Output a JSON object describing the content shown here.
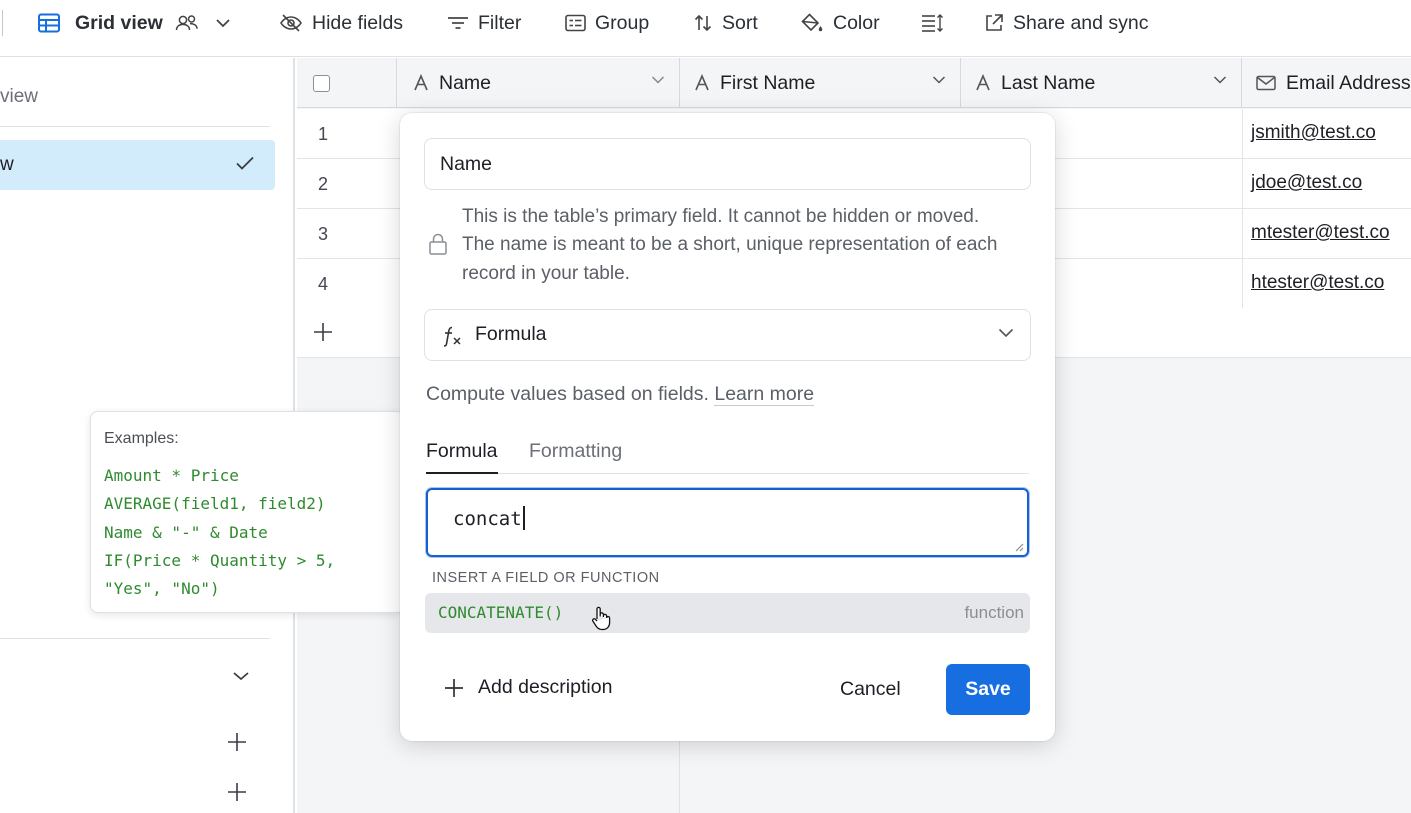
{
  "toolbar": {
    "view_name": "Grid view",
    "hide_fields": "Hide fields",
    "filter": "Filter",
    "group": "Group",
    "sort": "Sort",
    "color": "Color",
    "share_sync": "Share and sync"
  },
  "sidebar": {
    "search_fragment": "view",
    "active_view_fragment": "w"
  },
  "grid": {
    "columns": [
      {
        "label": "Name",
        "icon": "text-field-icon"
      },
      {
        "label": "First Name",
        "icon": "text-field-icon"
      },
      {
        "label": "Last Name",
        "icon": "text-field-icon"
      },
      {
        "label": "Email Address",
        "icon": "mail-icon"
      }
    ],
    "rows": [
      {
        "num": "1",
        "email": "jsmith@test.co"
      },
      {
        "num": "2",
        "email": "jdoe@test.co"
      },
      {
        "num": "3",
        "email": "mtester@test.co"
      },
      {
        "num": "4",
        "email": "htester@test.co"
      }
    ]
  },
  "examples": {
    "title": "Examples:",
    "lines": [
      "Amount * Price",
      "AVERAGE(field1, field2)",
      "Name & \"-\" & Date",
      "IF(Price * Quantity > 5,",
      "\"Yes\", \"No\")"
    ]
  },
  "dialog": {
    "field_name": "Name",
    "primary_note": "This is the table’s primary field. It cannot be hidden or moved. The name is meant to be a short, unique representation of each record in your table.",
    "field_type": "Formula",
    "compute_text": "Compute values based on fields.",
    "learn_more": "Learn more",
    "tabs": [
      "Formula",
      "Formatting"
    ],
    "formula_value": "concat",
    "insert_label": "INSERT A FIELD OR FUNCTION",
    "suggestion": {
      "name": "CONCATENATE()",
      "kind": "function"
    },
    "add_description": "Add description",
    "cancel": "Cancel",
    "save": "Save"
  },
  "colors": {
    "accent": "#166ee1",
    "focus_border": "#1660d0",
    "selected_view_bg": "#d2ecfb",
    "formula_green": "#2e8b2e"
  }
}
